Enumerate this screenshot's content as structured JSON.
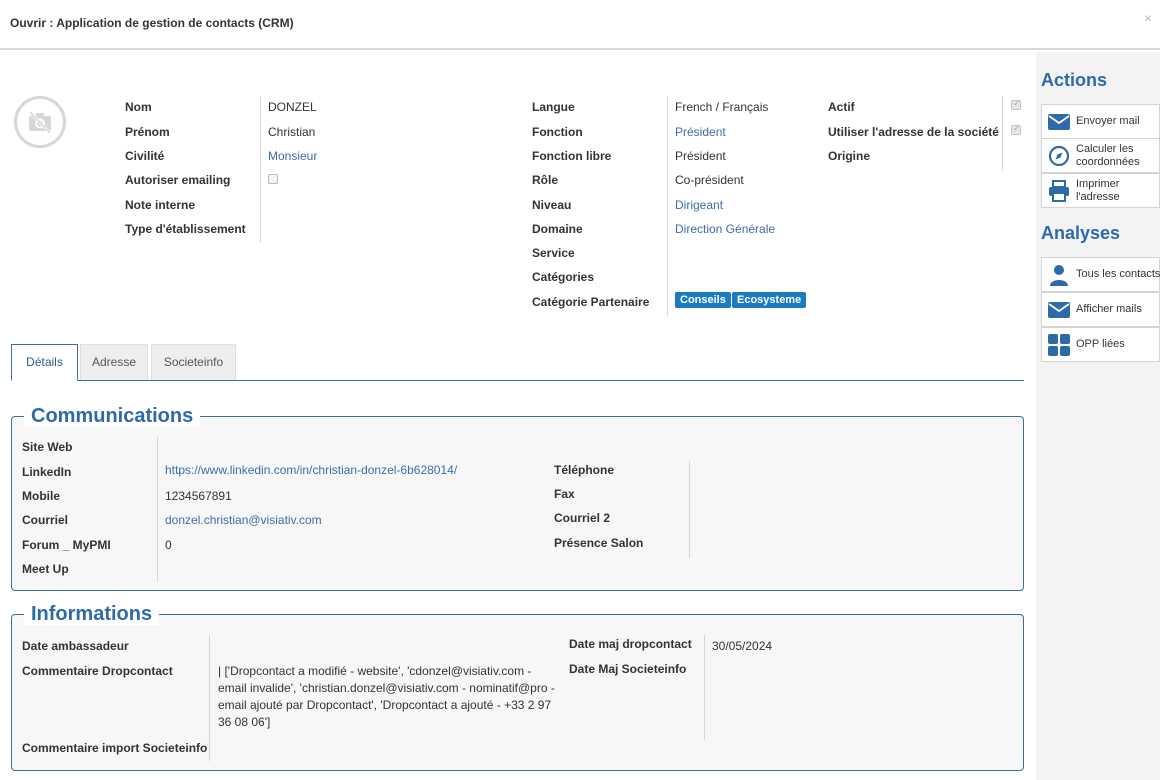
{
  "window": {
    "title": "Ouvrir : Application de gestion de contacts (CRM)",
    "close_glyph": "×"
  },
  "contact": {
    "col1": [
      {
        "label": "Nom",
        "value": "DONZEL"
      },
      {
        "label": "Prénom",
        "value": "Christian"
      },
      {
        "label": "Civilité",
        "value": "Monsieur"
      },
      {
        "label": "Autoriser emailing",
        "value": ""
      },
      {
        "label": "Note interne",
        "value": ""
      },
      {
        "label": "Type d'établissement",
        "value": ""
      }
    ],
    "col2": [
      {
        "label": "Langue",
        "value": "French / Français"
      },
      {
        "label": "Fonction",
        "value": "Président"
      },
      {
        "label": "Fonction libre",
        "value": "Président"
      },
      {
        "label": "Rôle",
        "value": "Co-président"
      },
      {
        "label": "Niveau",
        "value": "Dirigeant"
      },
      {
        "label": "Domaine",
        "value": "Direction Générale"
      },
      {
        "label": "Service",
        "value": ""
      },
      {
        "label": "Catégories",
        "value": ""
      },
      {
        "label": "Catégorie Partenaire",
        "value": ""
      }
    ],
    "partner_tags": [
      "Conseils",
      "Ecosysteme"
    ],
    "col3": [
      {
        "label": "Actif",
        "checked": true
      },
      {
        "label": "Utiliser l'adresse de la société",
        "checked": true
      },
      {
        "label": "Origine"
      }
    ],
    "autoriser_emailing_checked": false
  },
  "tabs": [
    {
      "label": "Détails",
      "active": true
    },
    {
      "label": "Adresse",
      "active": false
    },
    {
      "label": "Societeinfo",
      "active": false
    }
  ],
  "communications": {
    "title": "Communications",
    "left": [
      {
        "label": "Site Web",
        "value": ""
      },
      {
        "label": "LinkedIn",
        "value": "https://www.linkedin.com/in/christian-donzel-6b628014/"
      },
      {
        "label": "Mobile",
        "value": "1234567891"
      },
      {
        "label": "Courriel",
        "value": "donzel.christian@visiativ.com"
      },
      {
        "label": "Forum _ MyPMI",
        "value": "0"
      },
      {
        "label": "Meet Up",
        "value": ""
      }
    ],
    "right": [
      {
        "label": "Téléphone",
        "value": ""
      },
      {
        "label": "Fax",
        "value": ""
      },
      {
        "label": "Courriel 2",
        "value": ""
      },
      {
        "label": "Présence Salon",
        "value": ""
      }
    ]
  },
  "informations": {
    "title": "Informations",
    "left": [
      {
        "label": "Date ambassadeur",
        "value": ""
      },
      {
        "label": "Commentaire Dropcontact",
        "value": "| ['Dropcontact a modifié - website', 'cdonzel@visiativ.com - email invalide', 'christian.donzel@visiativ.com - nominatif@pro - email ajouté par Dropcontact', 'Dropcontact a ajouté - +33 2 97 36 08 06']"
      },
      {
        "label": "Commentaire import Societeinfo",
        "value": ""
      }
    ],
    "right": [
      {
        "label": "Date maj dropcontact",
        "value": "30/05/2024"
      },
      {
        "label": "Date Maj Societeinfo",
        "value": ""
      }
    ]
  },
  "sidebar": {
    "actions_title": "Actions",
    "actions": [
      {
        "label": "Envoyer mail",
        "icon": "envelope-icon"
      },
      {
        "label": "Calculer les coordonnées",
        "icon": "compass-icon"
      },
      {
        "label": "Imprimer l'adresse",
        "icon": "printer-icon"
      }
    ],
    "analyses_title": "Analyses",
    "analyses": [
      {
        "label": "Tous les contacts",
        "icon": "user-icon"
      },
      {
        "label": "Afficher mails",
        "icon": "envelope-icon"
      },
      {
        "label": "OPP liées",
        "icon": "grid-icon"
      }
    ]
  },
  "colors": {
    "accent": "#2e6aa8",
    "link": "#3a6ea8",
    "tag": "#1a7bbf",
    "border": "#3f6c9a"
  }
}
